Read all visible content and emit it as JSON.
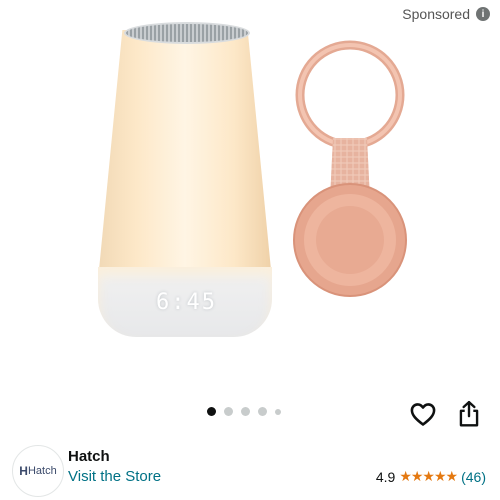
{
  "header": {
    "sponsored_label": "Sponsored",
    "info_glyph": "i"
  },
  "product_image": {
    "clock_display": "6:45",
    "alt_items": [
      "sound-machine-lamp",
      "pink-remote-keychain"
    ]
  },
  "carousel": {
    "total_images": 5,
    "active_index": 0
  },
  "actions": {
    "favorite_icon": "heart-icon",
    "share_icon": "share-icon"
  },
  "store": {
    "logo_text": "Hatch",
    "brand": "Hatch",
    "visit_label": "Visit the Store"
  },
  "rating": {
    "score": "4.9",
    "stars": "★★★★★",
    "count": "(46)"
  },
  "colors": {
    "link": "#007185",
    "star": "#e47911",
    "text": "#0f1111"
  }
}
